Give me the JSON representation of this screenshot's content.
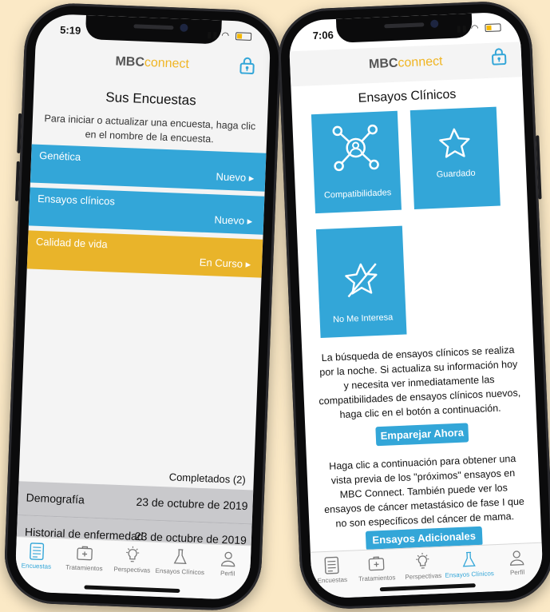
{
  "left": {
    "status": {
      "time": "5:19"
    },
    "logo": {
      "mbc": "MBC",
      "connect": "connect"
    },
    "title": "Sus Encuestas",
    "instructions": "Para iniciar o actualizar una encuesta, haga clic en el nombre de la encuesta.",
    "surveys": [
      {
        "name": "Genética",
        "status": "Nuevo",
        "color": "#33a6d8"
      },
      {
        "name": "Ensayos clínicos",
        "status": "Nuevo",
        "color": "#33a6d8"
      },
      {
        "name": "Calidad de vida",
        "status": "En Curso",
        "color": "#e9b42a"
      }
    ],
    "completed_header": "Completados (2)",
    "completed": [
      {
        "name": "Demografía",
        "date": "23 de octubre de 2019"
      },
      {
        "name": "Historial de enfermedad",
        "date": "23 de octubre de 2019"
      }
    ],
    "tabs": [
      "Encuestas",
      "Tratamientos",
      "Perspectivas",
      "Ensayos Clínicos",
      "Perfil"
    ],
    "active_tab": 0
  },
  "right": {
    "status": {
      "time": "7:06"
    },
    "logo": {
      "mbc": "MBC",
      "connect": "connect"
    },
    "title": "Ensayos Clínicos",
    "tiles": {
      "compat": "Compatibilidades",
      "saved": "Guardado",
      "not_interested": "No Me Interesa"
    },
    "para1": "La búsqueda de ensayos clínicos se realiza por la noche.  Si actualiza su información hoy y necesita ver inmediatamente las compatibilidades de ensayos clínicos nuevos, haga clic en el botón a continuación.",
    "match_button": "Emparejar Ahora",
    "para2": "Haga clic a continuación para obtener una vista previa de los \"próximos\" ensayos en MBC Connect. También puede ver los ensayos de cáncer metastásico de fase I que no son específicos del cáncer de mama.",
    "more_button": "Ensayos Adicionales",
    "tabs": [
      "Encuestas",
      "Tratamientos",
      "Perspectivas",
      "Ensayos Clínicos",
      "Perfil"
    ],
    "active_tab": 3
  },
  "colors": {
    "accent": "#33a6d8",
    "in_progress": "#e9b42a",
    "brand_gold": "#f0b523",
    "background": "#fbe9c6"
  }
}
